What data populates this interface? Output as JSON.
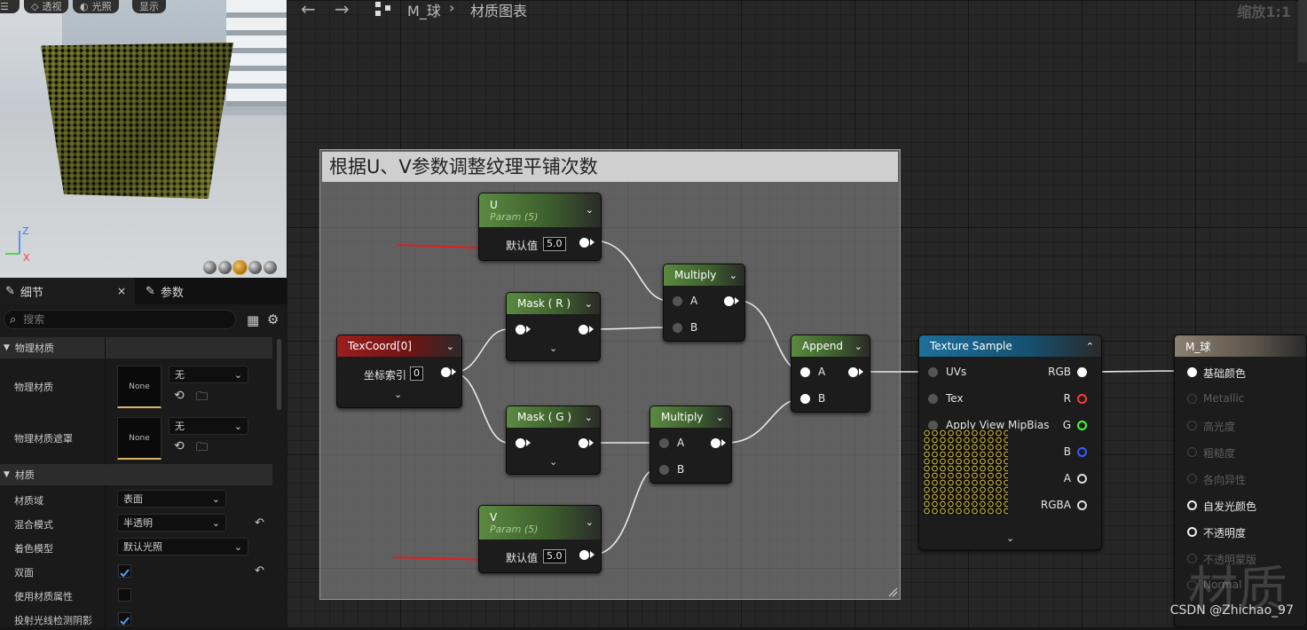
{
  "viewport": {
    "buttons": [
      {
        "icon": "hamburger-icon",
        "label": ""
      },
      {
        "icon": "perspective-icon",
        "label": "透视"
      },
      {
        "icon": "lighting-icon",
        "label": "光照"
      },
      {
        "icon": "show-icon",
        "label": "显示"
      }
    ],
    "axis_z": "Z",
    "axis_x": "X"
  },
  "details": {
    "tab_details": "细节",
    "tab_params": "参数",
    "search_placeholder": "搜索",
    "sections": [
      {
        "title": "物理材质"
      },
      {
        "title": "材质"
      }
    ],
    "phys_rows": [
      {
        "label": "物理材质",
        "thumb": "None",
        "combo": "无"
      },
      {
        "label": "物理材质遮罩",
        "thumb": "None",
        "combo": "无"
      }
    ],
    "mat_rows": [
      {
        "label": "材质域",
        "value": "表面"
      },
      {
        "label": "混合模式",
        "value": "半透明"
      },
      {
        "label": "着色模型",
        "value": "默认光照"
      },
      {
        "label": "双面",
        "checked": true
      },
      {
        "label": "使用材质属性",
        "checked": false
      },
      {
        "label": "投射光线检测阴影",
        "checked": true
      }
    ]
  },
  "graph": {
    "breadcrumb_asset": "M_球",
    "breadcrumb_graph": "材质图表",
    "zoom": "缩放1:1",
    "comment": "根据U、V参数调整纹理平铺次数",
    "nodes": {
      "u": {
        "title": "U",
        "sub": "Param (5)",
        "pin": "默认值",
        "value": "5.0"
      },
      "v": {
        "title": "V",
        "sub": "Param (5)",
        "pin": "默认值",
        "value": "5.0"
      },
      "texcoord": {
        "title": "TexCoord[0]",
        "pin": "坐标索引",
        "value": "0"
      },
      "mask_r": {
        "title": "Mask ( R )"
      },
      "mask_g": {
        "title": "Mask ( G )"
      },
      "mul1": {
        "title": "Multiply",
        "a": "A",
        "b": "B"
      },
      "mul2": {
        "title": "Multiply",
        "a": "A",
        "b": "B"
      },
      "append": {
        "title": "Append",
        "a": "A",
        "b": "B"
      },
      "texsample": {
        "title": "Texture Sample",
        "inputs": [
          "UVs",
          "Tex",
          "Apply View MipBias"
        ],
        "outputs": [
          "RGB",
          "R",
          "G",
          "B",
          "A",
          "RGBA"
        ]
      },
      "result": {
        "title": "M_球",
        "pins": [
          "基础颜色",
          "Metallic",
          "高光度",
          "粗糙度",
          "各向异性",
          "自发光颜色",
          "不透明度",
          "不透明蒙版",
          "Normal"
        ]
      }
    },
    "colors": {
      "pin_r": "#ff3a3a",
      "pin_g": "#3aff3a",
      "pin_b": "#3a5bff",
      "arrow": "#e02020"
    }
  },
  "watermark": "材质",
  "credit": "CSDN @Zhichao_97"
}
